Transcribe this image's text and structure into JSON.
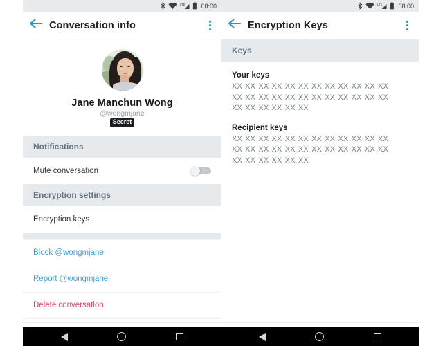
{
  "status_bar": {
    "time": "08:00",
    "icons": [
      "bluetooth-icon",
      "wifi-icon",
      "lte-signal-icon",
      "battery-icon"
    ],
    "network_label": "LTE"
  },
  "left_panel": {
    "appbar": {
      "back_icon": "back-arrow-icon",
      "title": "Conversation info",
      "overflow_icon": "overflow-menu-icon"
    },
    "profile": {
      "avatar_alt": "avatar",
      "name": "Jane Manchun Wong",
      "handle": "@wongmjane",
      "badge": "Secret"
    },
    "sections": [
      {
        "header": "Notifications",
        "rows": [
          {
            "label": "Mute conversation",
            "control": "toggle",
            "toggle_on": false
          }
        ]
      },
      {
        "header": "Encryption settings",
        "rows": [
          {
            "label": "Encryption keys",
            "control": "none"
          }
        ]
      }
    ],
    "actions": [
      {
        "label": "Block @wongmjane",
        "style": "link"
      },
      {
        "label": "Report @wongmjane",
        "style": "link"
      },
      {
        "label": "Delete conversation",
        "style": "danger"
      }
    ]
  },
  "right_panel": {
    "appbar": {
      "back_icon": "back-arrow-icon",
      "title": "Encryption Keys",
      "overflow_icon": "overflow-menu-icon"
    },
    "section_header": "Keys",
    "groups": [
      {
        "title": "Your keys",
        "value": "XX XX XX XX XX XX XX XX XX XX XX XX XX XX XX XX XX XX XX XX XX XX XX XX XX XX XX XX XX XX"
      },
      {
        "title": "Recipient keys",
        "value": "XX XX XX XX XX XX XX XX XX XX XX XX XX XX XX XX XX XX XX XX XX XX XX XX XX XX XX XX XX XX"
      }
    ]
  },
  "nav_bar": {
    "buttons": [
      "back-triangle-icon",
      "home-circle-icon",
      "recents-square-icon"
    ]
  },
  "colors": {
    "accent": "#2196c4",
    "link": "#3aa3d9",
    "danger": "#e0446d",
    "section_header_bg": "#e6eaec",
    "section_header_text": "#66737d",
    "status_bar_bg": "#e9eaec"
  }
}
